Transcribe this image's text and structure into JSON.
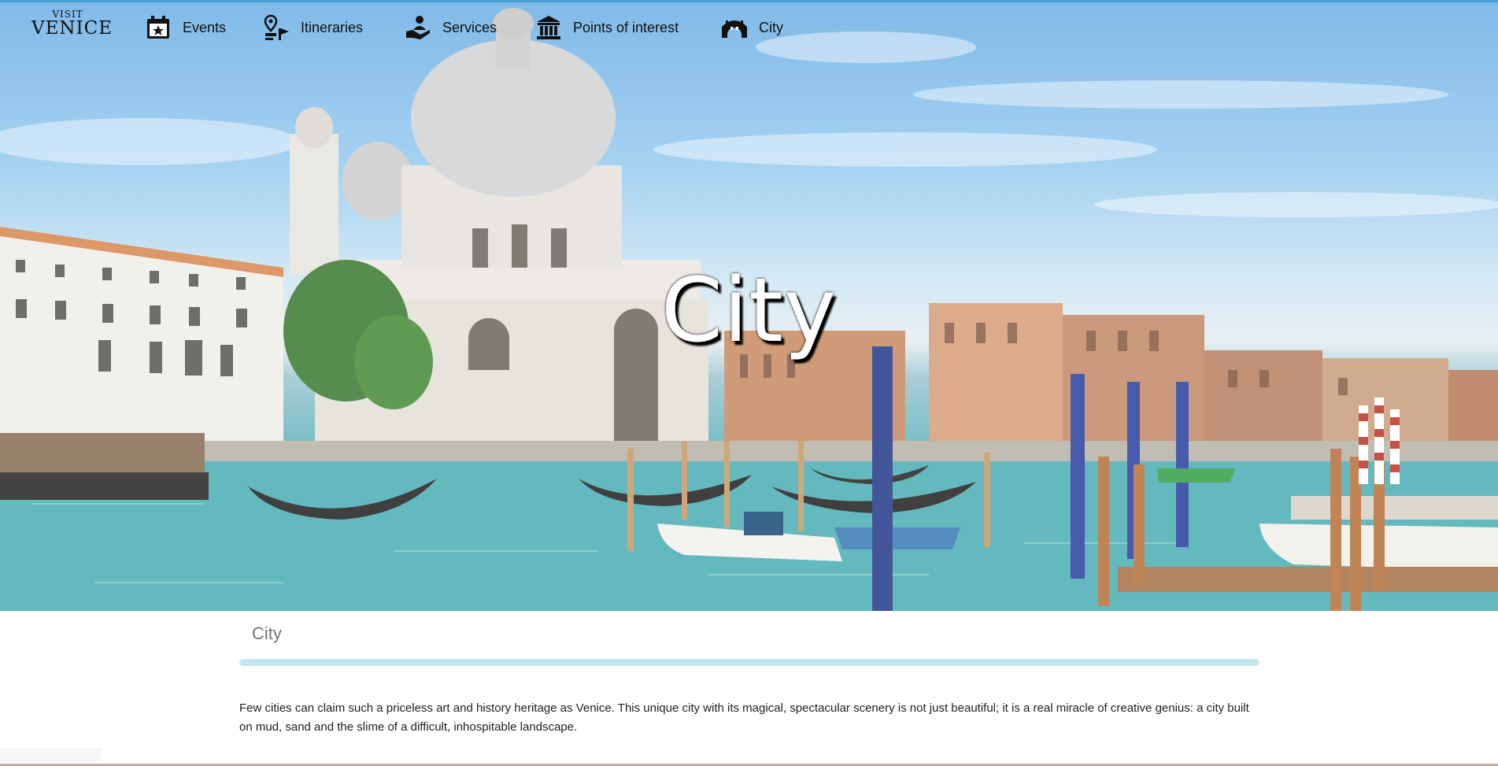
{
  "brand": {
    "top": "VISIT",
    "name": "VENICE"
  },
  "nav": {
    "items": [
      {
        "label": "Events",
        "icon": "calendar-star-icon"
      },
      {
        "label": "Itineraries",
        "icon": "route-pin-icon"
      },
      {
        "label": "Services",
        "icon": "hand-person-icon"
      },
      {
        "label": "Points of interest",
        "icon": "museum-icon"
      },
      {
        "label": "City",
        "icon": "bridge-icon"
      }
    ]
  },
  "hero": {
    "title": "City"
  },
  "page": {
    "section_title": "City",
    "intro": "Few cities can claim such a priceless art and history heritage as Venice. This unique city with its magical, spectacular scenery is not just beautiful; it is a real miracle of creative genius: a city built on mud, sand and the slime of a difficult, inhospitable landscape."
  },
  "colors": {
    "divider": "#c4e6f1",
    "section_title": "#6f7378",
    "water": "#4fb0b6",
    "sky": "#8fc3ea"
  }
}
